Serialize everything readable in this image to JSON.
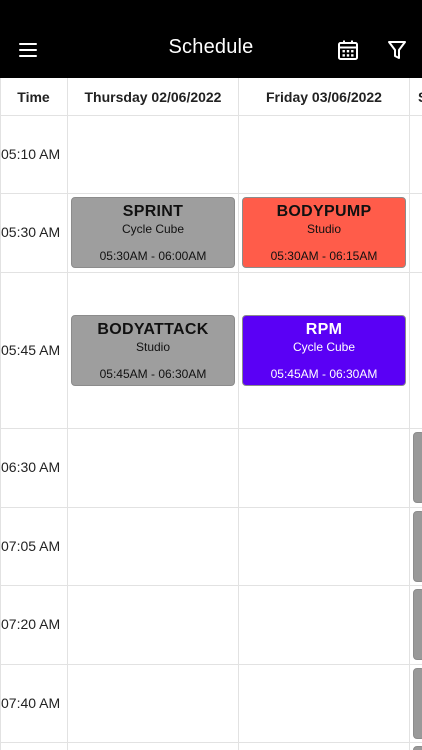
{
  "header": {
    "title": "Schedule",
    "menu_icon": "menu-icon",
    "calendar_icon": "calendar-icon",
    "filter_icon": "filter-icon"
  },
  "columns": {
    "time_label": "Time",
    "day1": "Thursday 02/06/2022",
    "day2": "Friday 03/06/2022",
    "day3": "S"
  },
  "times": [
    "05:10 AM",
    "05:30 AM",
    "05:45 AM",
    "06:30 AM",
    "07:05 AM",
    "07:20 AM",
    "07:40 AM"
  ],
  "classes": [
    {
      "name": "SPRINT",
      "location": "Cycle Cube",
      "time": "05:30AM - 06:00AM",
      "color": "#9e9e9e",
      "text_color": "#111111"
    },
    {
      "name": "BODYPUMP",
      "location": "Studio",
      "time": "05:30AM - 06:15AM",
      "color": "#ff5c4a",
      "text_color": "#111111"
    },
    {
      "name": "BODYATTACK",
      "location": "Studio",
      "time": "05:45AM - 06:30AM",
      "color": "#9e9e9e",
      "text_color": "#111111"
    },
    {
      "name": "RPM",
      "location": "Cycle Cube",
      "time": "05:45AM - 06:30AM",
      "color": "#5a00f5",
      "text_color": "#ffffff"
    }
  ]
}
